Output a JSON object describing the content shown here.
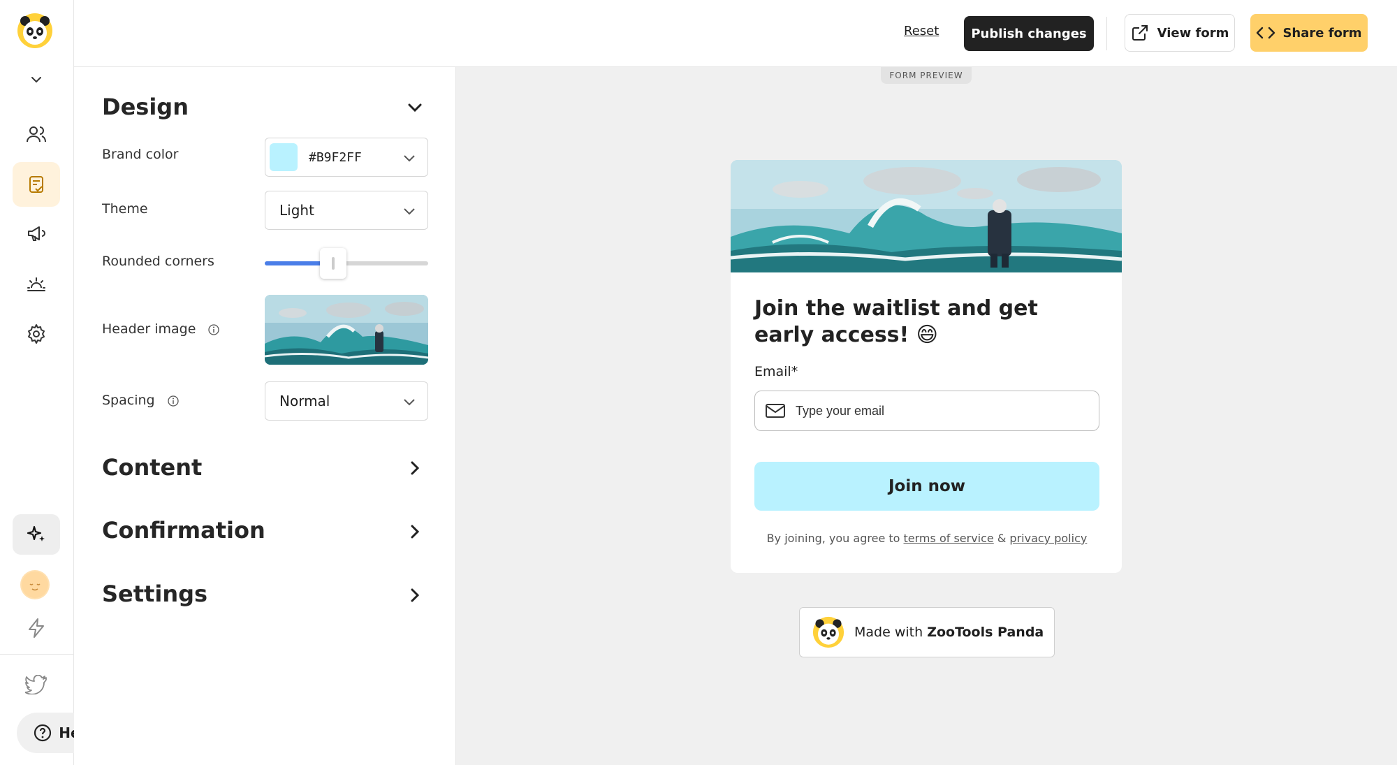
{
  "topbar": {
    "reset_label": "Reset",
    "publish_label": "Publish changes",
    "view_label": "View form",
    "share_label": "Share form"
  },
  "rail": {
    "icons": [
      "panda-logo-icon",
      "chevron-down-icon",
      "users-icon",
      "form-icon",
      "megaphone-icon",
      "sunrise-icon",
      "gear-icon",
      "sparkles-icon",
      "avatar",
      "lightning-icon",
      "twitter-icon"
    ],
    "help_label": "Help"
  },
  "design": {
    "title": "Design",
    "brand_color_label": "Brand color",
    "brand_color_value": "#B9F2FF",
    "theme_label": "Theme",
    "theme_value": "Light",
    "rounded_label": "Rounded corners",
    "rounded_level": 0.42,
    "header_image_label": "Header image",
    "spacing_label": "Spacing",
    "spacing_value": "Normal"
  },
  "sections": {
    "content": "Content",
    "confirmation": "Confirmation",
    "settings": "Settings"
  },
  "preview": {
    "tag": "FORM PREVIEW",
    "title": "Join the waitlist and get early access! 😄",
    "email_label": "Email*",
    "email_placeholder": "Type your email",
    "join_label": "Join now",
    "legal_prefix": "By joining, you agree to ",
    "terms_label": "terms of service",
    "legal_amp": " & ",
    "privacy_label": "privacy policy",
    "made_with_prefix": "Made with ",
    "made_with_brand": "ZooTools Panda"
  },
  "colors": {
    "brand": "#B9F2FF",
    "share_button": "#FFD06A",
    "publish_button": "#222222",
    "active_nav": "#FFF2DC"
  }
}
